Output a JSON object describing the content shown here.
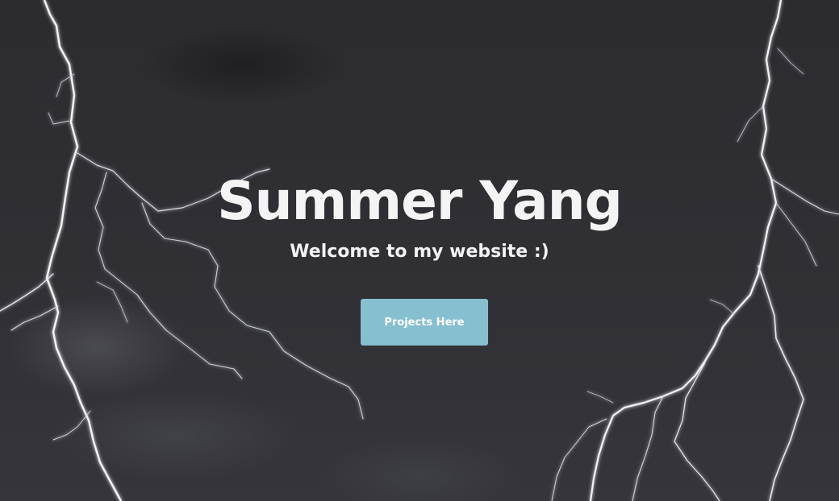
{
  "hero": {
    "title": "Summer Yang",
    "subtitle": "Welcome to my website :)",
    "cta_label": "Projects Here",
    "cta_color": "#86bfcf",
    "background_image": "lightning-storm-background"
  }
}
